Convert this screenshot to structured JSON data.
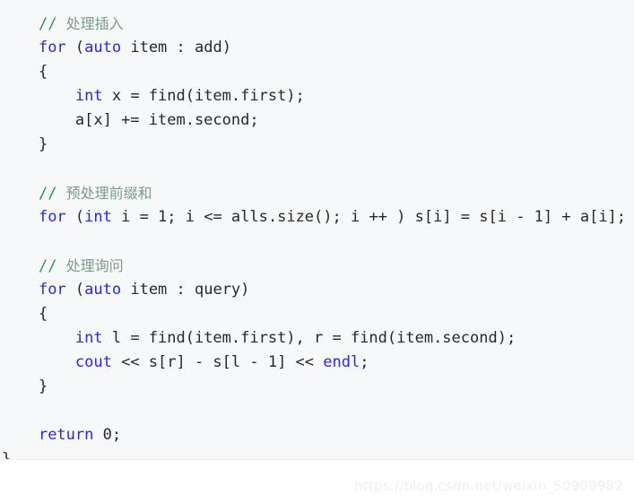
{
  "editor": {
    "language": "cpp",
    "background_color": "#f7f8fa",
    "page_background_color": "#ffffff",
    "colors": {
      "keyword": "#2727e6",
      "comment": "#2f8f56",
      "comment_cjk": "#7e9b88",
      "plain": "#24292e",
      "watermark": "#eeeff1"
    },
    "lines": [
      {
        "indent": 4,
        "tokens": [
          {
            "t": "// ",
            "c": "cm"
          },
          {
            "t": "处理插入",
            "c": "cm-cjk"
          }
        ]
      },
      {
        "indent": 4,
        "tokens": [
          {
            "t": "for",
            "c": "kw"
          },
          {
            "t": " (",
            "c": "pl"
          },
          {
            "t": "auto",
            "c": "kw"
          },
          {
            "t": " item : add)",
            "c": "pl"
          }
        ]
      },
      {
        "indent": 4,
        "tokens": [
          {
            "t": "{",
            "c": "pl"
          }
        ]
      },
      {
        "indent": 8,
        "tokens": [
          {
            "t": "int",
            "c": "kw"
          },
          {
            "t": " x = find(item.first);",
            "c": "pl"
          }
        ]
      },
      {
        "indent": 8,
        "tokens": [
          {
            "t": "a[x] += item.second;",
            "c": "pl"
          }
        ]
      },
      {
        "indent": 4,
        "tokens": [
          {
            "t": "}",
            "c": "pl"
          }
        ]
      },
      {
        "indent": 0,
        "tokens": []
      },
      {
        "indent": 4,
        "tokens": [
          {
            "t": "// ",
            "c": "cm"
          },
          {
            "t": "预处理前缀和",
            "c": "cm-cjk"
          }
        ]
      },
      {
        "indent": 4,
        "tokens": [
          {
            "t": "for",
            "c": "kw"
          },
          {
            "t": " (",
            "c": "pl"
          },
          {
            "t": "int",
            "c": "kw"
          },
          {
            "t": " i = 1; i <= alls.size(); i ++ ) s[i] = s[i - 1] + a[i];",
            "c": "pl"
          }
        ]
      },
      {
        "indent": 0,
        "tokens": []
      },
      {
        "indent": 4,
        "tokens": [
          {
            "t": "// ",
            "c": "cm"
          },
          {
            "t": "处理询问",
            "c": "cm-cjk"
          }
        ]
      },
      {
        "indent": 4,
        "tokens": [
          {
            "t": "for",
            "c": "kw"
          },
          {
            "t": " (",
            "c": "pl"
          },
          {
            "t": "auto",
            "c": "kw"
          },
          {
            "t": " item : query)",
            "c": "pl"
          }
        ]
      },
      {
        "indent": 4,
        "tokens": [
          {
            "t": "{",
            "c": "pl"
          }
        ]
      },
      {
        "indent": 8,
        "tokens": [
          {
            "t": "int",
            "c": "kw"
          },
          {
            "t": " l = find(item.first), r = find(item.second);",
            "c": "pl"
          }
        ]
      },
      {
        "indent": 8,
        "tokens": [
          {
            "t": "cout",
            "c": "kw"
          },
          {
            "t": " << s[r] - s[l - 1] << ",
            "c": "pl"
          },
          {
            "t": "endl",
            "c": "kw"
          },
          {
            "t": ";",
            "c": "pl"
          }
        ]
      },
      {
        "indent": 4,
        "tokens": [
          {
            "t": "}",
            "c": "pl"
          }
        ]
      },
      {
        "indent": 0,
        "tokens": []
      },
      {
        "indent": 4,
        "tokens": [
          {
            "t": "return",
            "c": "kw"
          },
          {
            "t": " 0;",
            "c": "pl"
          }
        ]
      },
      {
        "indent": 0,
        "tokens": [
          {
            "t": "}",
            "c": "pl"
          }
        ]
      }
    ]
  },
  "watermark": {
    "text": "https://blog.csdn.net/weixin_50909982"
  }
}
